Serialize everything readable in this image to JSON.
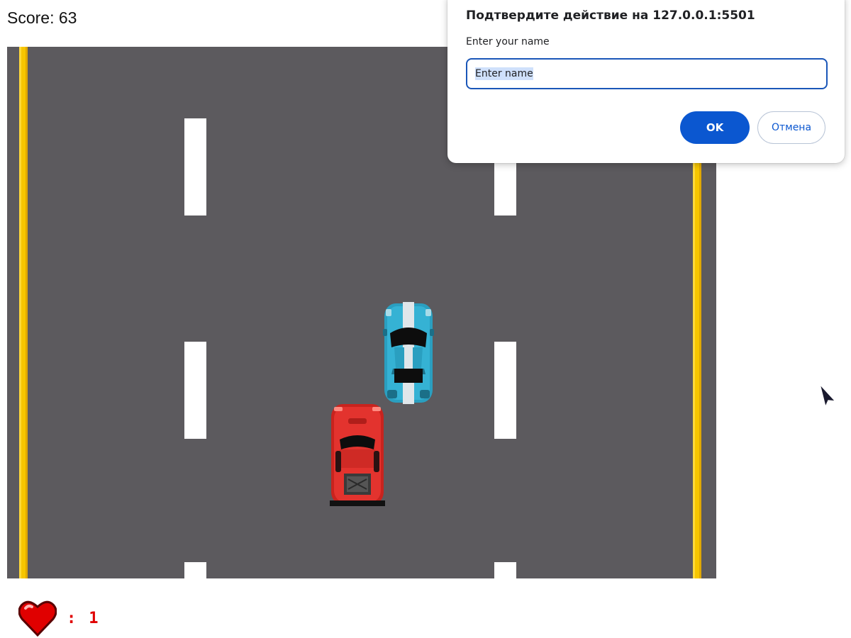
{
  "game": {
    "score_label": "Score: 63",
    "lives_separator": ":",
    "lives_value": "1",
    "colors": {
      "road": "#5c5a5e",
      "edge_line": "#f7c600",
      "lane_dash": "#ffffff",
      "player_car": "#e3332e",
      "enemy_car": "#2a9fc0",
      "heart": "#e00000"
    },
    "icons": {
      "lives": "heart-icon",
      "player": "red-car",
      "enemy": "blue-car"
    }
  },
  "dialog": {
    "title": "Подтвердите действие на 127.0.0.1:5501",
    "message": "Enter your name",
    "input_value": "Enter name",
    "ok_label": "OK",
    "cancel_label": "Отмена",
    "accent": "#0b57d0"
  }
}
